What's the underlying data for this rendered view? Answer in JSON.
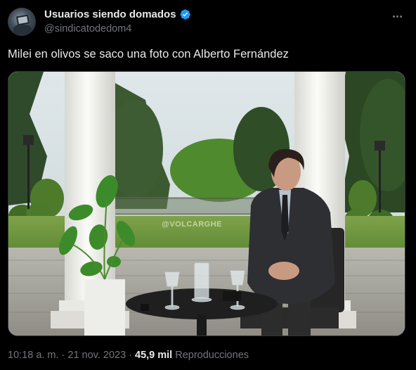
{
  "author": {
    "display_name": "Usuarios siendo domados",
    "handle": "@sindicatodedom4",
    "verified": true,
    "verified_color": "#1d9bf0"
  },
  "tweet": {
    "text": "Milei en olivos se saco una foto con Alberto Fernández"
  },
  "media": {
    "watermark": "@VOLCARGHE"
  },
  "meta": {
    "time": "10:18 a. m.",
    "separator": "·",
    "date": "21 nov. 2023",
    "views_count": "45,9 mil",
    "views_label": "Reproducciones"
  },
  "icons": [
    "avatar",
    "verified-badge-icon",
    "more-options-icon"
  ]
}
